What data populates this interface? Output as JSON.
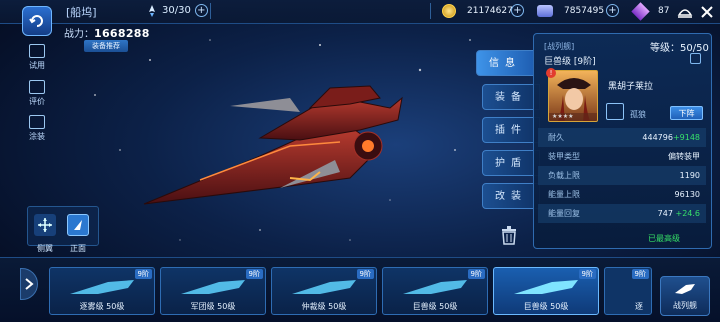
{
  "topbar": {
    "title": "[船坞]",
    "fleet_count": "30/30",
    "plus": "+",
    "gold": "21174627",
    "gems": "7857495",
    "crystals": "87"
  },
  "power": {
    "label": "战力：",
    "value": "1668288",
    "recommend_btn": "装备推荐"
  },
  "left_menu": [
    {
      "label": "试用",
      "icon": "check-box-icon"
    },
    {
      "label": "评价",
      "icon": "review-icon"
    },
    {
      "label": "涂装",
      "icon": "paint-icon"
    }
  ],
  "view": {
    "side_label": "侧翼",
    "front_label": "正面"
  },
  "tabs": [
    "信息",
    "装备",
    "插件",
    "护盾",
    "改装"
  ],
  "panel": {
    "class_label": "[战列舰]",
    "ship_name": "巨兽级 [9阶]",
    "level": "等级：50/50",
    "captain": "黑胡子莱拉",
    "captain_stars": "★★★★",
    "unload_btn": "下阵",
    "role": "孤狼",
    "stats": [
      {
        "label": "耐久",
        "value": "444796",
        "bonus": "+9148"
      },
      {
        "label": "装甲类型",
        "value": "偏转装甲",
        "bonus": ""
      },
      {
        "label": "负载上限",
        "value": "1190",
        "bonus": ""
      },
      {
        "label": "能量上限",
        "value": "96130",
        "bonus": ""
      },
      {
        "label": "能量回复",
        "value": "747",
        "bonus": "+24.6"
      }
    ],
    "maxed": "已最高级"
  },
  "ship_cards": [
    {
      "name": "逐雾级 50级",
      "tier": "9阶",
      "selected": false
    },
    {
      "name": "军团级 50级",
      "tier": "9阶",
      "selected": false
    },
    {
      "name": "仲裁级 50级",
      "tier": "9阶",
      "selected": false
    },
    {
      "name": "巨兽级 50级",
      "tier": "9阶",
      "selected": false
    },
    {
      "name": "巨兽级 50级",
      "tier": "9阶",
      "selected": true
    },
    {
      "name": "逐",
      "tier": "9阶",
      "selected": false
    }
  ],
  "battleship_btn": "战列舰",
  "colors": {
    "accent": "#3e93e8",
    "green": "#37e06a",
    "gold": "#ffd24a"
  }
}
